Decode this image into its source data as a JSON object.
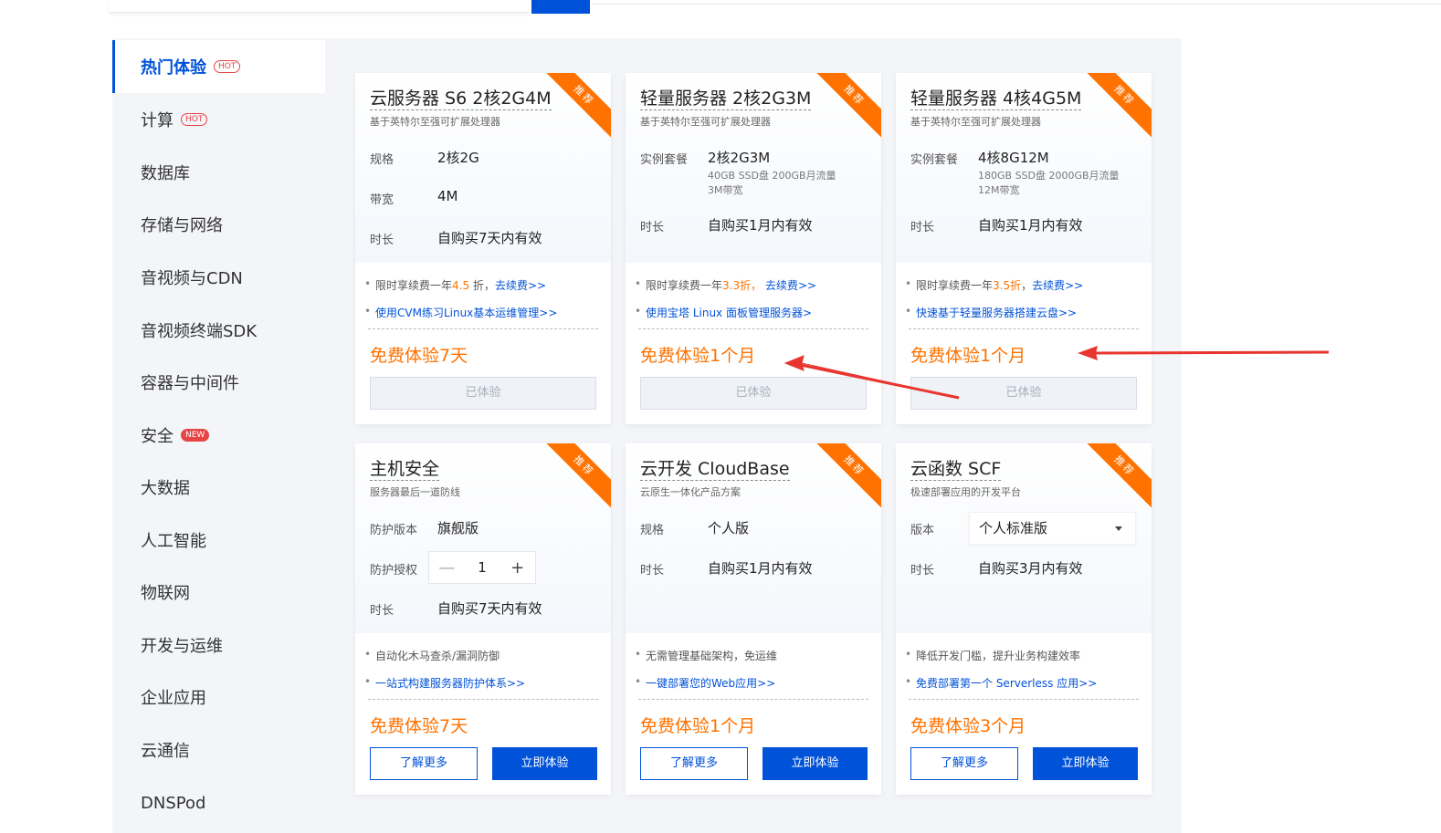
{
  "sidebar": {
    "items": [
      {
        "label": "热门体验",
        "tag": "HOT"
      },
      {
        "label": "计算",
        "tag": "HOT"
      },
      {
        "label": "数据库"
      },
      {
        "label": "存储与网络"
      },
      {
        "label": "音视频与CDN"
      },
      {
        "label": "音视频终端SDK"
      },
      {
        "label": "容器与中间件"
      },
      {
        "label": "安全",
        "tag": "NEW"
      },
      {
        "label": "大数据"
      },
      {
        "label": "人工智能"
      },
      {
        "label": "物联网"
      },
      {
        "label": "开发与运维"
      },
      {
        "label": "企业应用"
      },
      {
        "label": "云通信"
      },
      {
        "label": "DNSPod"
      }
    ]
  },
  "ribbon_label": "推荐",
  "cards": [
    {
      "title": "云服务器 S6 2核2G4M",
      "subtitle": "基于英特尔至强可扩展处理器",
      "spec1_label": "规格",
      "spec1_value": "2核2G",
      "spec2_label": "带宽",
      "spec2_value": "4M",
      "spec3_label": "时长",
      "spec3_value": "自购买7天内有效",
      "bullet1_pre": "限时享续费一年",
      "bullet1_hl": "4.5",
      "bullet1_mid": " 折，",
      "bullet1_link": "去续费>>",
      "bullet2_link": "使用CVM练习Linux基本运维管理>>",
      "price": "免费体验7天",
      "button": "已体验"
    },
    {
      "title": "轻量服务器 2核2G3M",
      "subtitle": "基于英特尔至强可扩展处理器",
      "spec1_label": "实例套餐",
      "spec1_value": "2核2G3M",
      "spec1_note1": "40GB SSD盘 200GB月流量",
      "spec1_note2": "3M带宽",
      "spec3_label": "时长",
      "spec3_value": "自购买1月内有效",
      "bullet1_pre": "限时享续费一年",
      "bullet1_hl": "3.3折，",
      "bullet1_mid": " ",
      "bullet1_link": "去续费>>",
      "bullet2_link": "使用宝塔 Linux 面板管理服务器>",
      "price": "免费体验1个月",
      "button": "已体验"
    },
    {
      "title": "轻量服务器 4核4G5M",
      "subtitle": "基于英特尔至强可扩展处理器",
      "spec1_label": "实例套餐",
      "spec1_value": "4核8G12M",
      "spec1_note1": "180GB SSD盘 2000GB月流量",
      "spec1_note2": "12M带宽",
      "spec3_label": "时长",
      "spec3_value": "自购买1月内有效",
      "bullet1_pre": "限时享续费一年",
      "bullet1_hl": "3.5折",
      "bullet1_mid": "，",
      "bullet1_link": "去续费>>",
      "bullet2_link": "快速基于轻量服务器搭建云盘>>",
      "price": "免费体验1个月",
      "button": "已体验"
    },
    {
      "title": "主机安全",
      "subtitle": "服务器最后一道防线",
      "spec1_label": "防护版本",
      "spec1_value": "旗舰版",
      "spec2_label": "防护授权",
      "stepper_minus": "—",
      "stepper_value": "1",
      "stepper_plus": "+",
      "spec3_label": "时长",
      "spec3_value": "自购买7天内有效",
      "bullet1_text": "自动化木马查杀/漏洞防御",
      "bullet2_link": "一站式构建服务器防护体系>>",
      "price": "免费体验7天",
      "learn_more": "了解更多",
      "try_now": "立即体验"
    },
    {
      "title": "云开发 CloudBase",
      "subtitle": "云原生一体化产品方案",
      "spec1_label": "规格",
      "spec1_value": "个人版",
      "spec2_label": "时长",
      "spec2_value": "自购买1月内有效",
      "bullet1_text": "无需管理基础架构，免运维",
      "bullet2_link": "一键部署您的Web应用>>",
      "price": "免费体验1个月",
      "learn_more": "了解更多",
      "try_now": "立即体验"
    },
    {
      "title": "云函数 SCF",
      "subtitle": "极速部署应用的开发平台",
      "spec1_label": "版本",
      "select_value": "个人标准版",
      "spec2_label": "时长",
      "spec2_value": "自购买3月内有效",
      "bullet1_text": "降低开发门槛，提升业务构建效率",
      "bullet2_link": "免费部署第一个 Serverless 应用>>",
      "price": "免费体验3个月",
      "learn_more": "了解更多",
      "try_now": "立即体验"
    }
  ],
  "colors": {
    "accent": "#0052d9",
    "orange": "#ff7200",
    "arrow": "#e8352e"
  }
}
